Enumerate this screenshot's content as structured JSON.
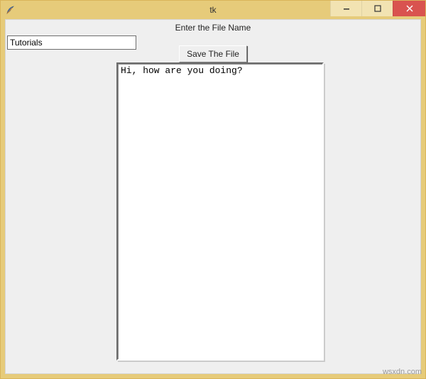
{
  "window": {
    "title": "tk"
  },
  "prompt": {
    "label": "Enter the File Name"
  },
  "filename": {
    "value": "Tutorials"
  },
  "buttons": {
    "save": "Save The File"
  },
  "textarea": {
    "content": "Hi, how are you doing?"
  },
  "watermark": "wsxdn.com"
}
